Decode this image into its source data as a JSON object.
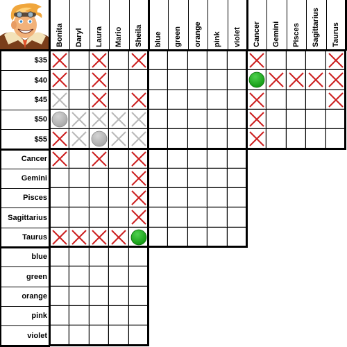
{
  "puzzle": {
    "names": [
      "Bonita",
      "Daryl",
      "Laura",
      "Mario",
      "Sheila"
    ],
    "colors": [
      "blue",
      "green",
      "orange",
      "pink",
      "violet"
    ],
    "signs": [
      "Cancer",
      "Gemini",
      "Pisces",
      "Sagittarius",
      "Taurus"
    ],
    "prices": [
      "$35",
      "$40",
      "$45",
      "$50",
      "$55"
    ]
  },
  "column_headers": [
    "Bonita",
    "Daryl",
    "Laura",
    "Mario",
    "Sheila",
    "blue",
    "green",
    "orange",
    "pink",
    "violet",
    "Cancer",
    "Gemini",
    "Pisces",
    "Sagittarius",
    "Taurus"
  ],
  "row_headers": [
    "$35",
    "$40",
    "$45",
    "$50",
    "$55",
    "Cancer",
    "Gemini",
    "Pisces",
    "Sagittarius",
    "Taurus",
    "blue",
    "green",
    "orange",
    "pink",
    "violet"
  ],
  "mark_legend": {
    "X": "red-x (eliminated)",
    "x": "grey-x (auto-eliminated)",
    "O": "green-circle (confirmed)",
    "o": "grey-circle (auto-confirmed)",
    "_": "empty"
  },
  "colors_hex": {
    "red_x": "#cc1f1f",
    "grey_x": "#b8b8b8",
    "green_circle": "#119911",
    "grey_circle": "#a8a8a8"
  },
  "blocks": {
    "prices_x_names": [
      [
        "X",
        "_",
        "X",
        "_",
        "X"
      ],
      [
        "X",
        "_",
        "X",
        "_",
        "_"
      ],
      [
        "x",
        "_",
        "X",
        "_",
        "X"
      ],
      [
        "o",
        "x",
        "x",
        "x",
        "x"
      ],
      [
        "X",
        "x",
        "o",
        "x",
        "x"
      ]
    ],
    "prices_x_colors": [
      [
        "_",
        "_",
        "_",
        "_",
        "_"
      ],
      [
        "_",
        "_",
        "_",
        "_",
        "_"
      ],
      [
        "_",
        "_",
        "_",
        "_",
        "_"
      ],
      [
        "_",
        "_",
        "_",
        "_",
        "_"
      ],
      [
        "_",
        "_",
        "_",
        "_",
        "_"
      ]
    ],
    "prices_x_signs": [
      [
        "X",
        "_",
        "_",
        "_",
        "X"
      ],
      [
        "O",
        "X",
        "X",
        "X",
        "X"
      ],
      [
        "X",
        "_",
        "_",
        "_",
        "X"
      ],
      [
        "X",
        "_",
        "_",
        "_",
        "_"
      ],
      [
        "X",
        "_",
        "_",
        "_",
        "_"
      ]
    ],
    "signs_x_names": [
      [
        "X",
        "_",
        "X",
        "_",
        "X"
      ],
      [
        "_",
        "_",
        "_",
        "_",
        "X"
      ],
      [
        "_",
        "_",
        "_",
        "_",
        "X"
      ],
      [
        "_",
        "_",
        "_",
        "_",
        "X"
      ],
      [
        "X",
        "X",
        "X",
        "X",
        "O"
      ]
    ],
    "signs_x_colors": [
      [
        "_",
        "_",
        "_",
        "_",
        "_"
      ],
      [
        "_",
        "_",
        "_",
        "_",
        "_"
      ],
      [
        "_",
        "_",
        "_",
        "_",
        "_"
      ],
      [
        "_",
        "_",
        "_",
        "_",
        "_"
      ],
      [
        "_",
        "_",
        "_",
        "_",
        "_"
      ]
    ],
    "colors_x_names": [
      [
        "_",
        "_",
        "_",
        "_",
        "_"
      ],
      [
        "_",
        "_",
        "_",
        "_",
        "_"
      ],
      [
        "_",
        "_",
        "_",
        "_",
        "_"
      ],
      [
        "_",
        "_",
        "_",
        "_",
        "_"
      ],
      [
        "_",
        "_",
        "_",
        "_",
        "_"
      ]
    ]
  }
}
